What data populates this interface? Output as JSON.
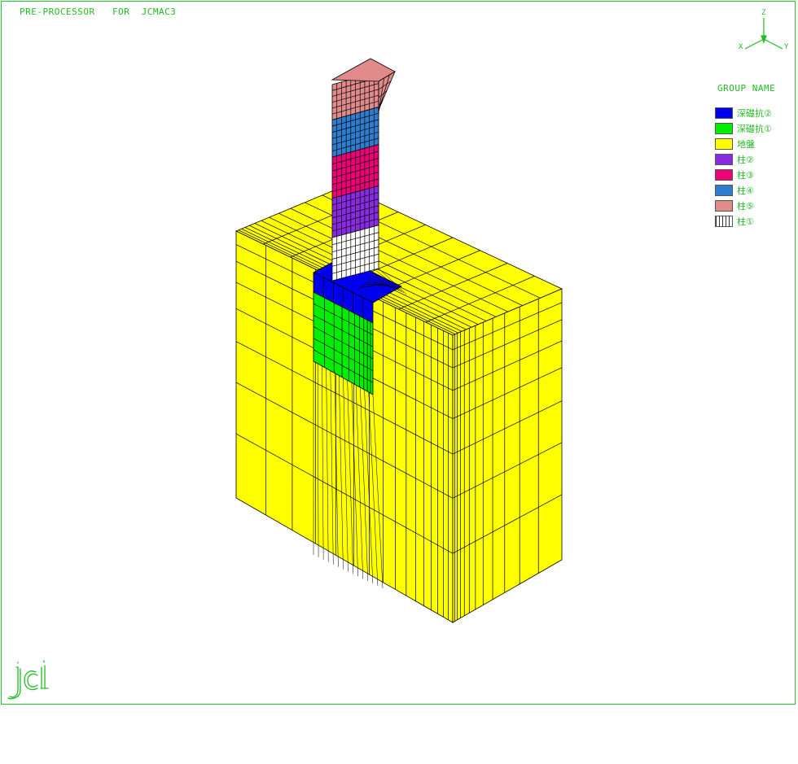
{
  "header": {
    "title": "PRE-PROCESSOR   FOR  JCMAC3"
  },
  "axes": {
    "z": "Z",
    "x": "X",
    "y": "Y"
  },
  "legend": {
    "title": "GROUP NAME",
    "items": [
      {
        "label": "深礎抗②",
        "color": "#0000ee"
      },
      {
        "label": "深礎抗①",
        "color": "#00ee00"
      },
      {
        "label": "地盤",
        "color": "#ffff00"
      },
      {
        "label": "柱②",
        "color": "#8a2be2"
      },
      {
        "label": "柱③",
        "color": "#ee0077"
      },
      {
        "label": "柱④",
        "color": "#2e7dd1"
      },
      {
        "label": "柱⑤",
        "color": "#e08a8a"
      },
      {
        "label": "柱①",
        "color": "#ffffff"
      }
    ]
  },
  "colors": {
    "frame": "#22cc22",
    "text": "#22bb22",
    "mesh": "#000000"
  },
  "logo": "jci-logo"
}
